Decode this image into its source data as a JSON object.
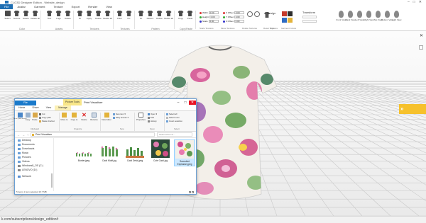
{
  "window": {
    "title": "CLO3D Designer Edition - Website_design",
    "controls": [
      "–",
      "□",
      "✕"
    ]
  },
  "menubar": [
    "File",
    "Avatar",
    "Garment",
    "Texture",
    "Export",
    "Render",
    "View"
  ],
  "ribbon": {
    "groups": [
      {
        "label": "Color",
        "tools": [
          "Select",
          "Texture",
          "Delete",
          "Delete all"
        ]
      },
      {
        "label": "Assets",
        "tools": [
          "Text",
          "Logo",
          "Delete"
        ]
      },
      {
        "label": "Textures",
        "tools": [
          "Fit",
          "Apply",
          "Delete",
          "Delete all"
        ]
      },
      {
        "label": "Textures",
        "tools": [
          "Fitter",
          "Fix"
        ]
      },
      {
        "label": "Pattern",
        "tools": [
          "Fit",
          "Pattern",
          "Delete",
          "Delete all"
        ]
      },
      {
        "label": "Copy/Paste",
        "tools": [
          "Copy",
          "Paste"
        ]
      }
    ],
    "fields": [
      {
        "label": "Width",
        "value": "0.00"
      },
      {
        "label": "Height",
        "value": "0.00"
      },
      {
        "label": "Scale",
        "value": "0.00"
      },
      {
        "label": "X Offset",
        "value": "0.00"
      },
      {
        "label": "Y Offset",
        "value": "0.00"
      },
      {
        "label": "Z Offset",
        "value": "0.00"
      }
    ],
    "sub_groups": [
      "Scale Textures",
      "Move Textures",
      "Rotate Textures",
      "Reset Textures",
      "Style",
      "Garment Colors"
    ],
    "design_label": "Design",
    "transform_label": "Transform",
    "views": [
      "Front View",
      "Back View",
      "Left View",
      "Right View",
      "Top View",
      "Bottom View",
      "Light View"
    ]
  },
  "viewport": {
    "side_tab": "»",
    "close": "✕"
  },
  "status_bar": {
    "url_text": "k.com/subscriptions/design_edition#"
  },
  "explorer": {
    "context_tab": "Picture Tools",
    "title": "Print Visualiser",
    "controls": [
      "–",
      "□",
      "✕"
    ],
    "tabs": [
      "File",
      "Home",
      "Share",
      "View",
      "Manage"
    ],
    "ribbon": {
      "clipboard": {
        "pin": "Pin to Quick access",
        "copy": "Copy",
        "paste": "Paste",
        "cut": "Cut",
        "copy_path": "Copy path",
        "paste_shortcut": "Paste shortcut",
        "label": "Clipboard"
      },
      "organize": {
        "move": "Move to",
        "copy": "Copy to",
        "delete": "Delete",
        "rename": "Rename",
        "label": "Organize"
      },
      "new": {
        "folder": "New folder",
        "item": "New item ▾",
        "easy": "Easy access ▾",
        "label": "New"
      },
      "open": {
        "properties": "Properties",
        "open": "Open ▾",
        "edit": "Edit",
        "history": "History",
        "label": "Open"
      },
      "select": {
        "all": "Select all",
        "none": "Select none",
        "invert": "Invert selection",
        "label": "Select"
      }
    },
    "address": {
      "path": "Print Visualiser",
      "search_placeholder": "Search Print Vi..."
    },
    "nav": [
      {
        "label": "Desktop"
      },
      {
        "label": "Documents"
      },
      {
        "label": "Downloads"
      },
      {
        "label": "Music"
      },
      {
        "label": "Pictures"
      },
      {
        "label": "Videos"
      },
      {
        "label": "Windows8_OS (C:)"
      },
      {
        "label": "LENOVO (D:)"
      },
      {
        "label": "Network"
      }
    ],
    "files": [
      {
        "name": "Border.jpeg",
        "selected": false
      },
      {
        "name": "Cacti Motif.jpg",
        "selected": false
      },
      {
        "name": "Cacti Desk.jpeg",
        "selected": false
      },
      {
        "name": "Cute Cacti.jpg",
        "selected": false
      },
      {
        "name": "Succulent Explosion.jpeg",
        "selected": true
      }
    ],
    "status": "5 items    1 item selected  19.7 MB"
  },
  "colors": {
    "accent_blue": "#1f6fb3",
    "side_tab_yellow": "#f6c12c",
    "explorer_file_tab": "#1979ca",
    "close_red": "#e81123"
  }
}
